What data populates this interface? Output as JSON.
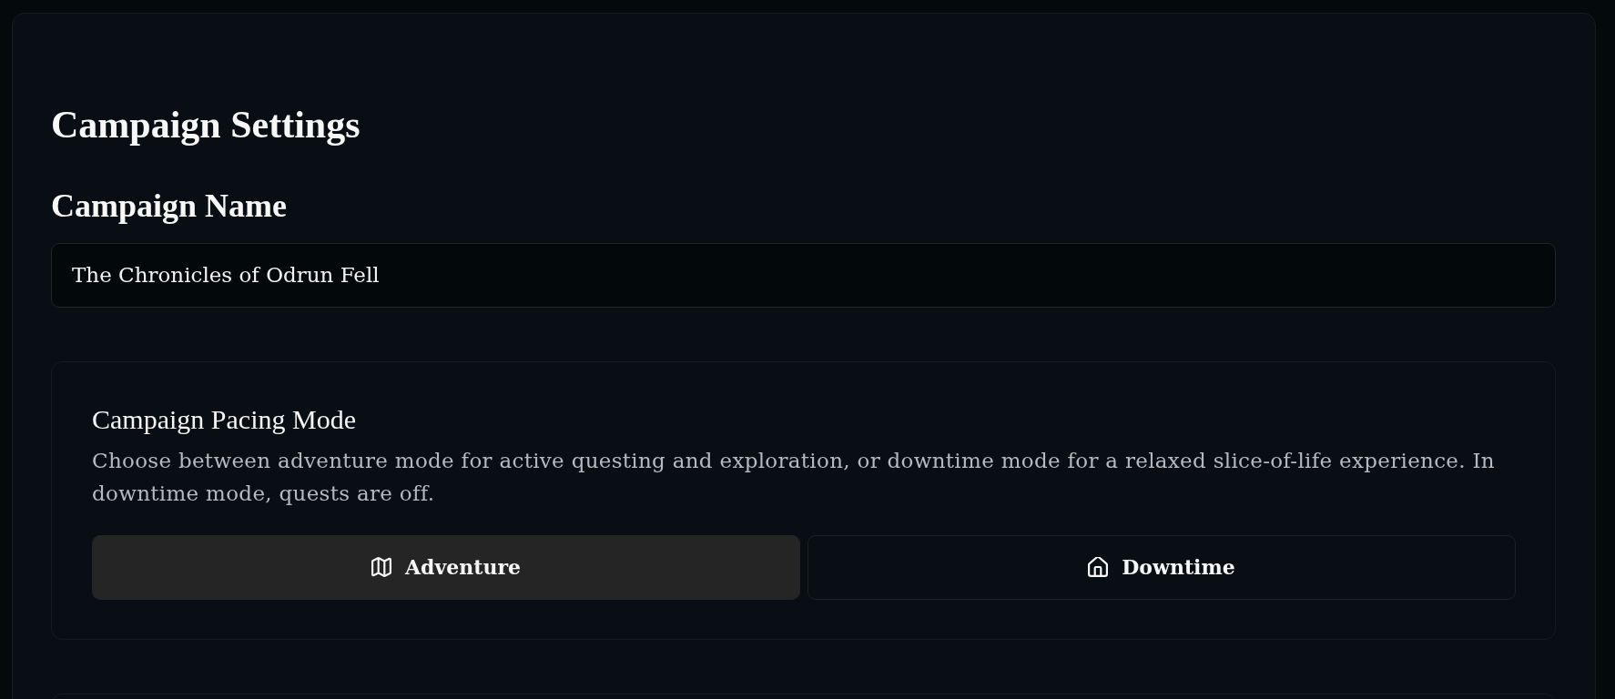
{
  "page": {
    "title": "Campaign Settings"
  },
  "campaign_name": {
    "label": "Campaign Name",
    "value": "The Chronicles of Odrun Fell"
  },
  "pacing": {
    "title": "Campaign Pacing Mode",
    "description": "Choose between adventure mode for active questing and exploration, or downtime mode for a relaxed slice-of-life experience. In downtime mode, quests are off.",
    "options": [
      {
        "label": "Adventure",
        "selected": true
      },
      {
        "label": "Downtime",
        "selected": false
      }
    ]
  }
}
